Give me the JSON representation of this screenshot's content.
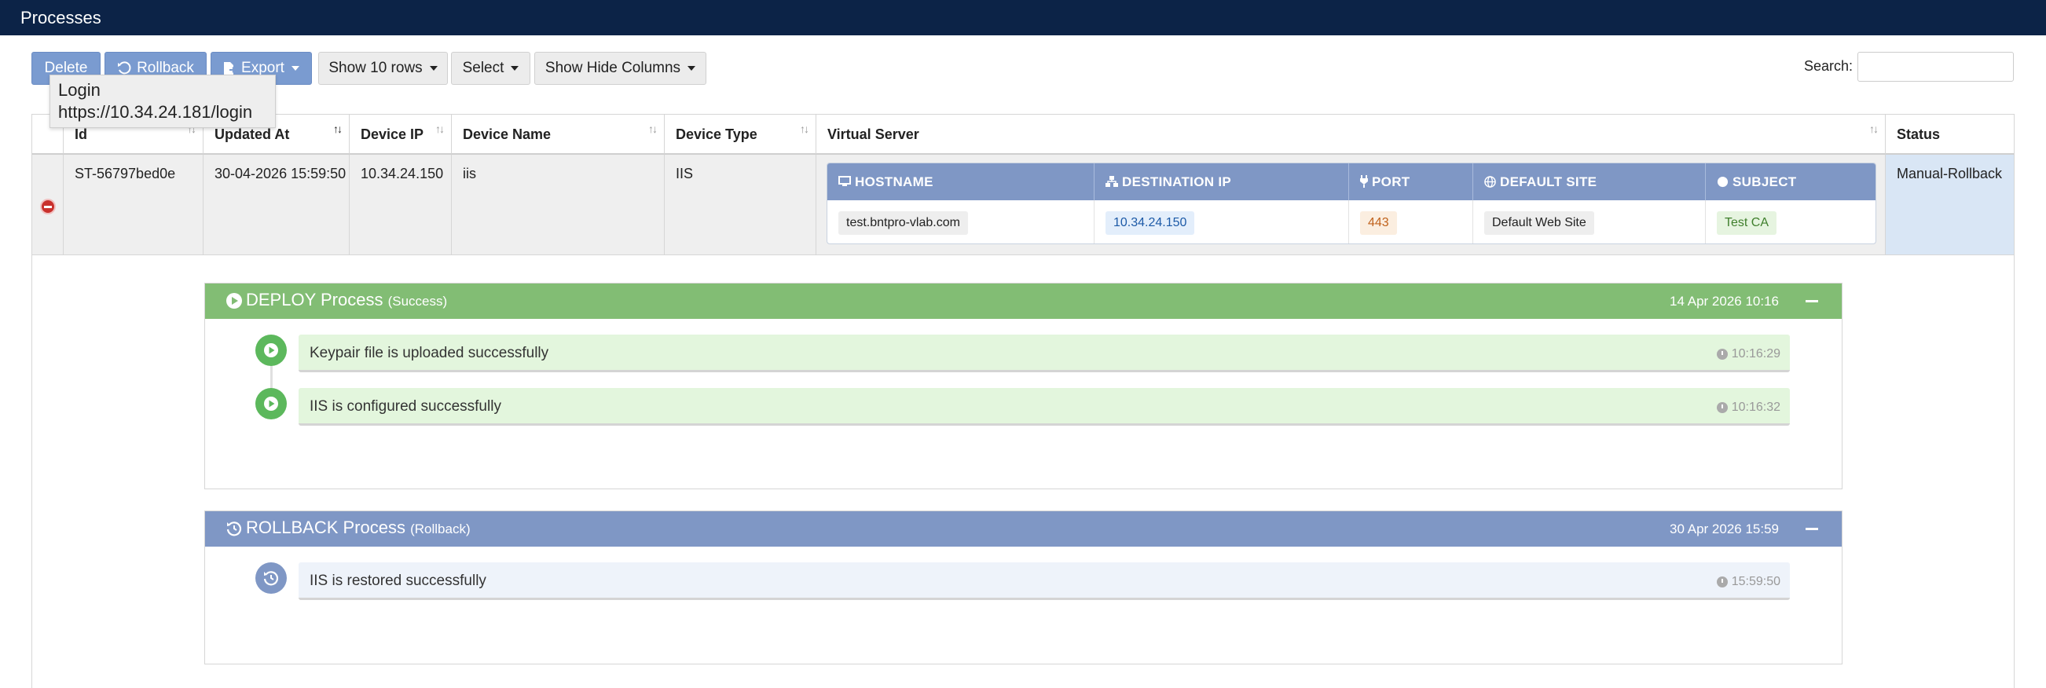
{
  "header": {
    "title": "Processes"
  },
  "toolbar": {
    "delete_label": "Delete",
    "rollback_label": "Rollback",
    "export_label": "Export",
    "rows_label": "Show 10 rows",
    "select_label": "Select",
    "columns_label": "Show Hide Columns",
    "search_label": "Search:",
    "search_value": ""
  },
  "tooltip": {
    "line1": "Login",
    "line2": "https://10.34.24.181/login"
  },
  "table": {
    "columns": [
      "Id",
      "Updated At",
      "Device IP",
      "Device Name",
      "Device Type",
      "Virtual Server",
      "Status"
    ],
    "row": {
      "id": "ST-56797bed0e",
      "updated_at": "30-04-2026 15:59:50",
      "device_ip": "10.34.24.150",
      "device_name": "iis",
      "device_type": "IIS",
      "status": "Manual-Rollback"
    },
    "virtual_server": {
      "headers": [
        "HOSTNAME",
        "DESTINATION IP",
        "PORT",
        "DEFAULT SITE",
        "SUBJECT"
      ],
      "hostname": "test.bntpro-vlab.com",
      "destination_ip": "10.34.24.150",
      "port": "443",
      "default_site": "Default Web Site",
      "subject": "Test CA"
    }
  },
  "processes": [
    {
      "title": "DEPLOY Process",
      "state": "(Success)",
      "time": "14 Apr 2026 10:16",
      "color": "#82bd74",
      "steps": [
        {
          "text": "Keypair file is uploaded successfully",
          "time": "10:16:29"
        },
        {
          "text": "IIS is configured successfully",
          "time": "10:16:32"
        }
      ]
    },
    {
      "title": "ROLLBACK Process",
      "state": "(Rollback)",
      "time": "30 Apr 2026 15:59",
      "color": "#7f97c5",
      "steps": [
        {
          "text": "IIS is restored successfully",
          "time": "15:59:50"
        }
      ]
    }
  ],
  "colors": {
    "topbar": "#0c2347",
    "button_blue": "#7a9bd0",
    "success": "#82bd74",
    "rollback": "#7f97c5",
    "status_cell": "#d9e6f5"
  }
}
